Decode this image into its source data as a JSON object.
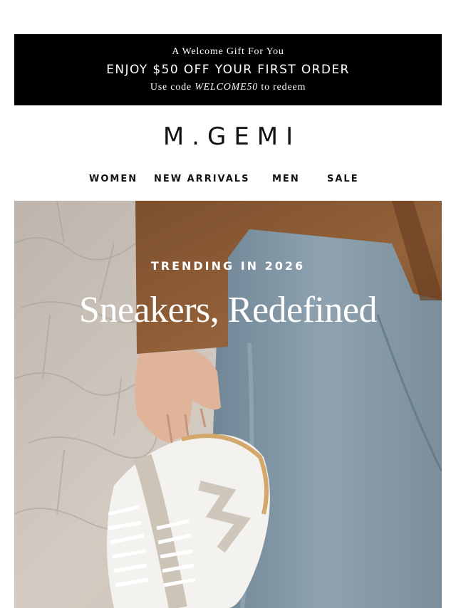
{
  "promo": {
    "line1": "A Welcome Gift For You",
    "line2": "ENJOY $50 OFF YOUR FIRST ORDER",
    "line3_prefix": "Use code ",
    "line3_code": "WELCOME50",
    "line3_suffix": " to redeem"
  },
  "brand": {
    "logo_text": "M.GEMI"
  },
  "nav": {
    "items": [
      {
        "label": "WOMEN"
      },
      {
        "label": "NEW ARRIVALS"
      },
      {
        "label": "MEN"
      },
      {
        "label": "SALE"
      }
    ]
  },
  "hero": {
    "eyebrow": "TRENDING IN 2026",
    "headline": "Sneakers, Redefined"
  },
  "colors": {
    "promo_bg": "#000000",
    "text_dark": "#111111",
    "hero_text": "#ffffff",
    "jacket": "#8a5a34",
    "denim": "#7f95a5"
  }
}
